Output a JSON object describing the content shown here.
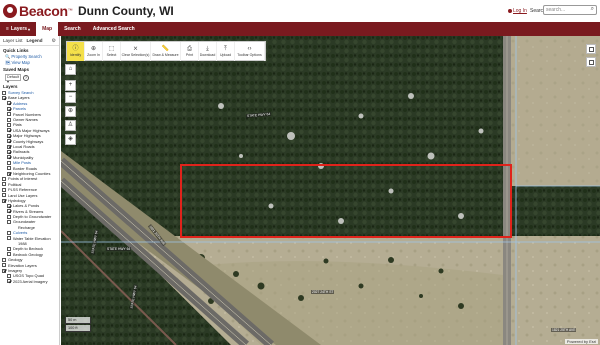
{
  "header": {
    "brand": "Beacon",
    "brand_tm": "™",
    "county": "Dunn County, WI",
    "login": "Log In",
    "search_label": "Search",
    "search_placeholder": "search...",
    "brand_color": "#8a1a1f"
  },
  "nav": {
    "items": [
      {
        "label": "Layers",
        "caret": "▾"
      },
      {
        "label": "Map"
      },
      {
        "label": "Search"
      },
      {
        "label": "Advanced Search"
      }
    ],
    "active": "Map"
  },
  "sidebar": {
    "tabs": [
      "Layer List",
      "Legend"
    ],
    "quick_links_title": "Quick Links",
    "quick_links": [
      "Property Search",
      "View Map"
    ],
    "saved_maps_title": "Saved Maps",
    "saved_maps_value": "Default",
    "layers_title": "Layers",
    "layers": [
      {
        "label": "Survey Search",
        "level": 0,
        "checked": false,
        "link": true
      },
      {
        "label": "Base Layers",
        "level": 0,
        "checked": true,
        "link": false
      },
      {
        "label": "Address",
        "level": 1,
        "checked": true,
        "link": true
      },
      {
        "label": "Parcels",
        "level": 1,
        "checked": true,
        "link": true
      },
      {
        "label": "Parcel Numbers",
        "level": 1,
        "checked": false,
        "link": false
      },
      {
        "label": "Owner Names",
        "level": 1,
        "checked": false,
        "link": false
      },
      {
        "label": "Plats",
        "level": 1,
        "checked": false,
        "link": false
      },
      {
        "label": "USA Major Highways",
        "level": 1,
        "checked": true,
        "link": false
      },
      {
        "label": "Major Highways",
        "level": 1,
        "checked": true,
        "link": false
      },
      {
        "label": "County Highways",
        "level": 1,
        "checked": true,
        "link": false
      },
      {
        "label": "Local Roads",
        "level": 1,
        "checked": true,
        "link": false
      },
      {
        "label": "Railroads",
        "level": 1,
        "checked": true,
        "link": false
      },
      {
        "label": "Municipality",
        "level": 1,
        "checked": true,
        "link": false
      },
      {
        "label": "Mile Posts",
        "level": 1,
        "checked": false,
        "link": true
      },
      {
        "label": "Border Roads",
        "level": 1,
        "checked": false,
        "link": false
      },
      {
        "label": "Neighboring Counties",
        "level": 1,
        "checked": true,
        "link": false
      },
      {
        "label": "Points of Interest",
        "level": 0,
        "checked": false,
        "link": false
      },
      {
        "label": "Political",
        "level": 0,
        "checked": false,
        "link": false
      },
      {
        "label": "PLSS Reference",
        "level": 0,
        "checked": false,
        "link": false
      },
      {
        "label": "Land Use Layers",
        "level": 0,
        "checked": false,
        "link": false
      },
      {
        "label": "Hydrology",
        "level": 0,
        "checked": true,
        "link": false
      },
      {
        "label": "Lakes & Ponds",
        "level": 1,
        "checked": true,
        "link": false
      },
      {
        "label": "Rivers & Streams",
        "level": 1,
        "checked": true,
        "link": false
      },
      {
        "label": "Depth to Groundwater",
        "level": 1,
        "checked": false,
        "link": false
      },
      {
        "label": "Groundwater",
        "level": 1,
        "checked": false,
        "link": false
      },
      {
        "label": "Recharge",
        "level": 2,
        "checked": null,
        "link": false
      },
      {
        "label": "Culverts",
        "level": 1,
        "checked": false,
        "link": true
      },
      {
        "label": "Water Table Elevation",
        "level": 1,
        "checked": false,
        "link": false
      },
      {
        "label": "1988",
        "level": 2,
        "checked": null,
        "link": false
      },
      {
        "label": "Depth to Bedrock",
        "level": 1,
        "checked": false,
        "link": false
      },
      {
        "label": "Bedrock Geology",
        "level": 1,
        "checked": false,
        "link": false
      },
      {
        "label": "Geology",
        "level": 0,
        "checked": false,
        "link": false
      },
      {
        "label": "Elevation Layers",
        "level": 0,
        "checked": false,
        "link": false
      },
      {
        "label": "Imagery",
        "level": 0,
        "checked": true,
        "link": false
      },
      {
        "label": "USGS Topo Quad",
        "level": 1,
        "checked": false,
        "link": false
      },
      {
        "label": "2023 Aerial Imagery",
        "level": 1,
        "checked": true,
        "link": false
      }
    ]
  },
  "toolbar": {
    "items": [
      {
        "label": "Identify",
        "icon": "info-icon"
      },
      {
        "label": "Zoom In",
        "icon": "zoom-in-icon"
      },
      {
        "label": "Select",
        "icon": "select-icon"
      },
      {
        "label": "Clear Selection(s)",
        "icon": "clear-icon"
      },
      {
        "label": "Draw & Measure",
        "icon": "ruler-icon"
      },
      {
        "label": "Print",
        "icon": "print-icon"
      },
      {
        "label": "Download",
        "icon": "download-icon"
      },
      {
        "label": "Upload",
        "icon": "upload-icon"
      },
      {
        "label": "Toolbar Options",
        "icon": "code-icon"
      }
    ],
    "active": "Identify"
  },
  "map": {
    "scale": [
      "50 m",
      "100 ft"
    ],
    "labels": [
      "STATE HWY 64",
      "STATE HWY 64",
      "STATE HWY 64",
      "STATE HWY 64",
      "1821 25TH AVE",
      "2027 24TH ST"
    ],
    "powered_by": "Powered by Esri",
    "selection_color": "#e0231b"
  }
}
